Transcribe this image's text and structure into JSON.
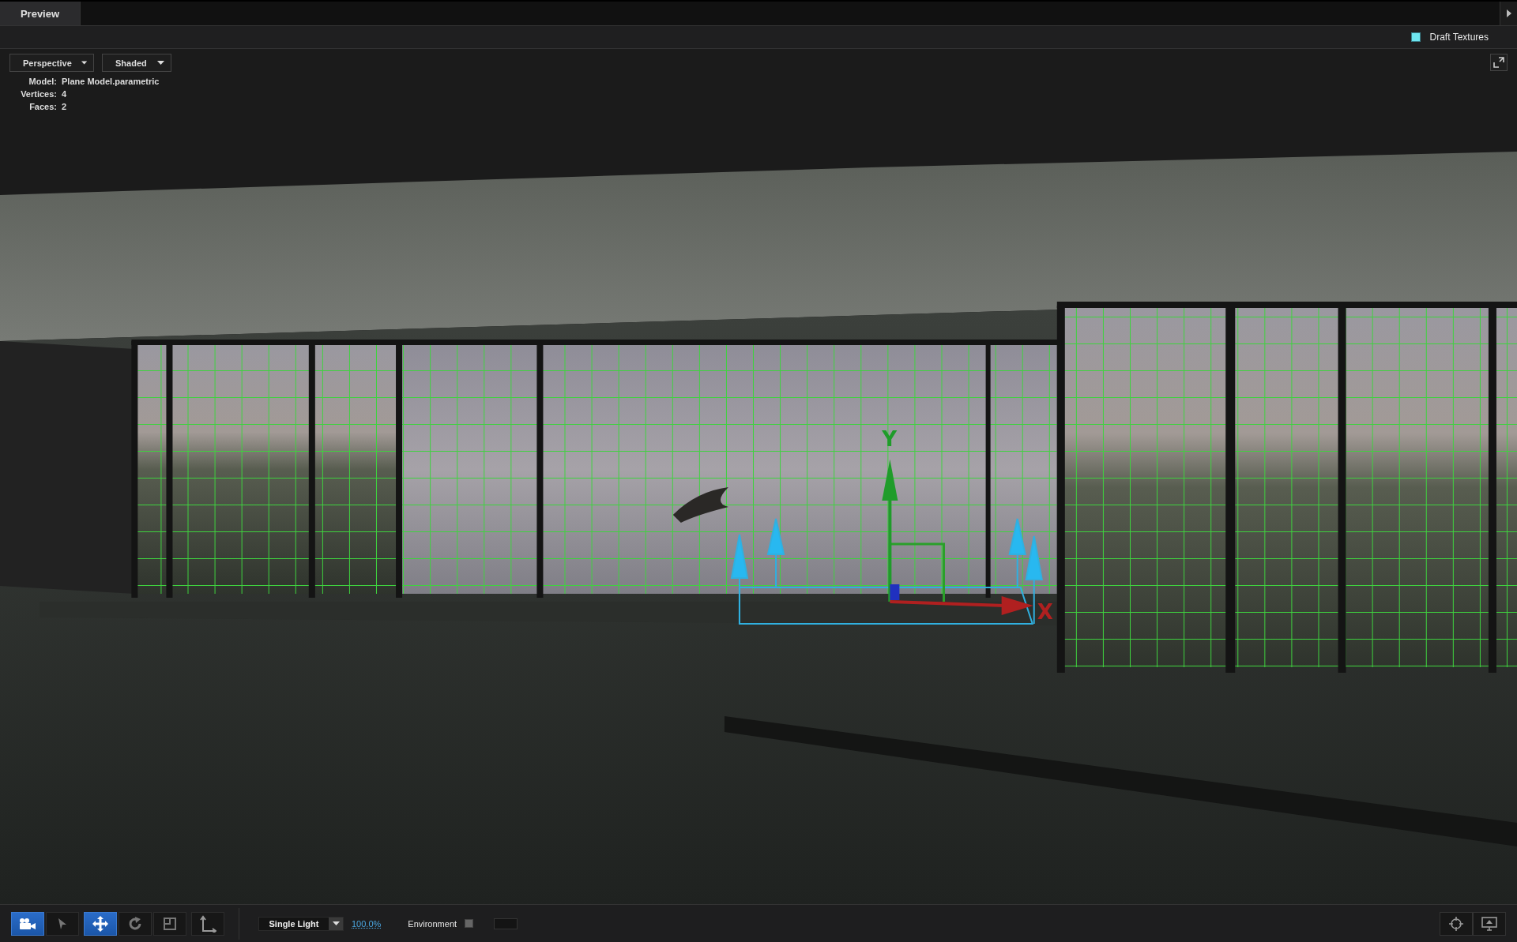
{
  "tabs": [
    {
      "label": "Preview",
      "selected": true
    }
  ],
  "draft_textures": {
    "label": "Draft Textures",
    "checked": true
  },
  "view_dropdowns": [
    {
      "value": "Perspective"
    },
    {
      "value": "Shaded"
    }
  ],
  "model_info": [
    {
      "label": "Model:",
      "value": "Plane Model.parametric"
    },
    {
      "label": "Vertices:",
      "value": "4"
    },
    {
      "label": "Faces:",
      "value": "2"
    }
  ],
  "gizmo": {
    "y_label": "Y",
    "x_label": "X"
  },
  "tool_groups": [
    {
      "tools": [
        {
          "kind": "camera",
          "selected": true
        },
        {
          "kind": "pointer",
          "selected": false
        }
      ]
    },
    {
      "tools": [
        {
          "kind": "move",
          "selected": true
        },
        {
          "kind": "rotate",
          "selected": false
        },
        {
          "kind": "scale",
          "selected": false
        }
      ]
    },
    {
      "tools": [
        {
          "kind": "axes",
          "selected": false
        }
      ]
    }
  ],
  "lighting": {
    "value": "Single Light"
  },
  "zoom": "100.0%",
  "environment": {
    "label": "Environment",
    "checked": false
  },
  "view_buttons": [
    {
      "kind": "target"
    },
    {
      "kind": "display"
    }
  ]
}
